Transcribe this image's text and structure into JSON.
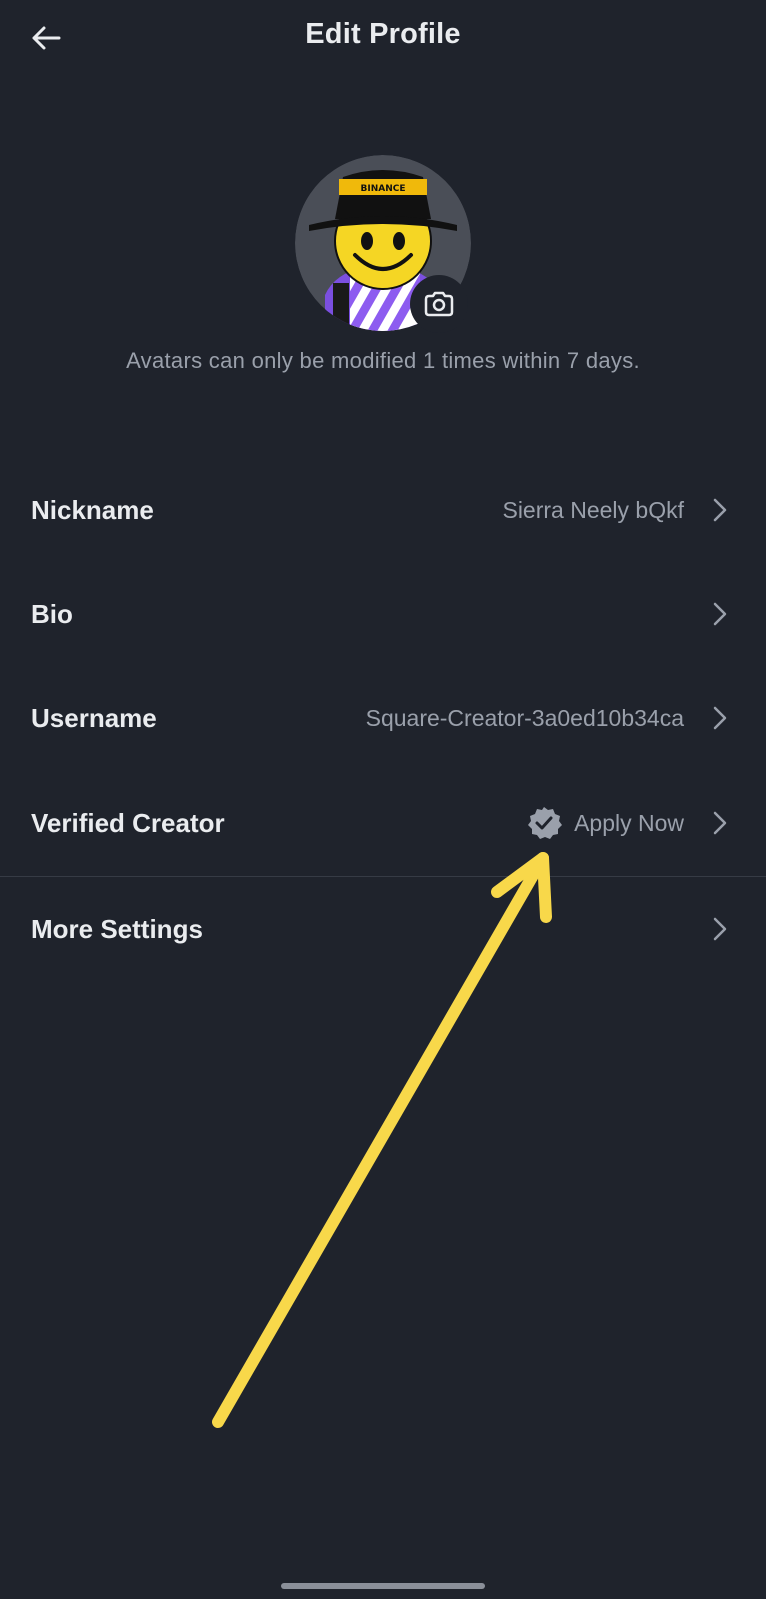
{
  "header": {
    "title": "Edit Profile",
    "back_icon": "arrow-left-icon"
  },
  "avatar": {
    "badge_text": "BINANCE",
    "camera_icon": "camera-icon",
    "note": "Avatars can only be modified 1 times within 7 days."
  },
  "rows": {
    "nickname": {
      "label": "Nickname",
      "value": "Sierra Neely bQkf"
    },
    "bio": {
      "label": "Bio"
    },
    "username": {
      "label": "Username",
      "value": "Square-Creator-3a0ed10b34ca"
    },
    "verified": {
      "label": "Verified Creator",
      "value": "Apply Now",
      "icon": "verified-badge-icon"
    },
    "more": {
      "label": "More Settings"
    }
  },
  "colors": {
    "background": "#1f232c",
    "text_primary": "#eaecef",
    "text_secondary": "#9aa0ab",
    "annotation_arrow": "#f8d84a",
    "brand_yellow": "#f0b90b"
  }
}
